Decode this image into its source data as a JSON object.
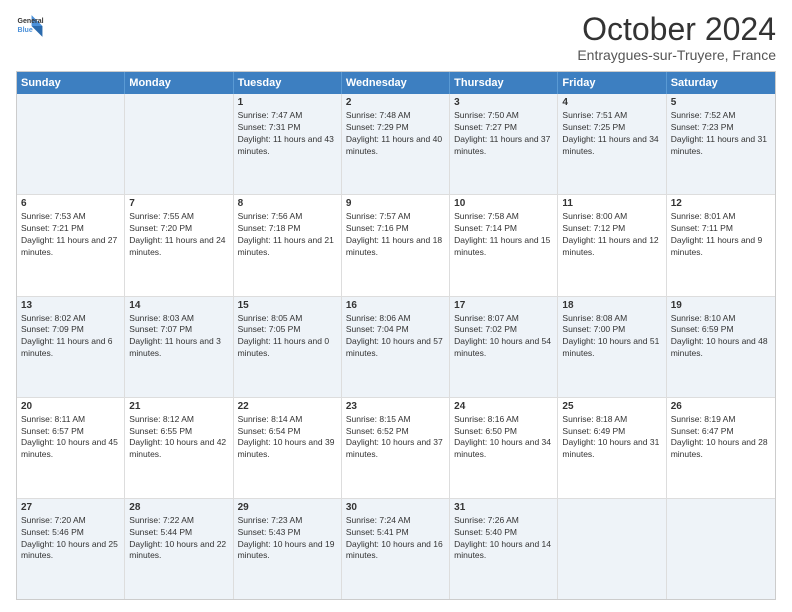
{
  "logo": {
    "line1": "General",
    "line2": "Blue"
  },
  "title": "October 2024",
  "location": "Entraygues-sur-Truyere, France",
  "header": {
    "days": [
      "Sunday",
      "Monday",
      "Tuesday",
      "Wednesday",
      "Thursday",
      "Friday",
      "Saturday"
    ]
  },
  "weeks": [
    [
      {
        "day": "",
        "sunrise": "",
        "sunset": "",
        "daylight": "",
        "empty": true
      },
      {
        "day": "",
        "sunrise": "",
        "sunset": "",
        "daylight": "",
        "empty": true
      },
      {
        "day": "1",
        "sunrise": "Sunrise: 7:47 AM",
        "sunset": "Sunset: 7:31 PM",
        "daylight": "Daylight: 11 hours and 43 minutes."
      },
      {
        "day": "2",
        "sunrise": "Sunrise: 7:48 AM",
        "sunset": "Sunset: 7:29 PM",
        "daylight": "Daylight: 11 hours and 40 minutes."
      },
      {
        "day": "3",
        "sunrise": "Sunrise: 7:50 AM",
        "sunset": "Sunset: 7:27 PM",
        "daylight": "Daylight: 11 hours and 37 minutes."
      },
      {
        "day": "4",
        "sunrise": "Sunrise: 7:51 AM",
        "sunset": "Sunset: 7:25 PM",
        "daylight": "Daylight: 11 hours and 34 minutes."
      },
      {
        "day": "5",
        "sunrise": "Sunrise: 7:52 AM",
        "sunset": "Sunset: 7:23 PM",
        "daylight": "Daylight: 11 hours and 31 minutes."
      }
    ],
    [
      {
        "day": "6",
        "sunrise": "Sunrise: 7:53 AM",
        "sunset": "Sunset: 7:21 PM",
        "daylight": "Daylight: 11 hours and 27 minutes."
      },
      {
        "day": "7",
        "sunrise": "Sunrise: 7:55 AM",
        "sunset": "Sunset: 7:20 PM",
        "daylight": "Daylight: 11 hours and 24 minutes."
      },
      {
        "day": "8",
        "sunrise": "Sunrise: 7:56 AM",
        "sunset": "Sunset: 7:18 PM",
        "daylight": "Daylight: 11 hours and 21 minutes."
      },
      {
        "day": "9",
        "sunrise": "Sunrise: 7:57 AM",
        "sunset": "Sunset: 7:16 PM",
        "daylight": "Daylight: 11 hours and 18 minutes."
      },
      {
        "day": "10",
        "sunrise": "Sunrise: 7:58 AM",
        "sunset": "Sunset: 7:14 PM",
        "daylight": "Daylight: 11 hours and 15 minutes."
      },
      {
        "day": "11",
        "sunrise": "Sunrise: 8:00 AM",
        "sunset": "Sunset: 7:12 PM",
        "daylight": "Daylight: 11 hours and 12 minutes."
      },
      {
        "day": "12",
        "sunrise": "Sunrise: 8:01 AM",
        "sunset": "Sunset: 7:11 PM",
        "daylight": "Daylight: 11 hours and 9 minutes."
      }
    ],
    [
      {
        "day": "13",
        "sunrise": "Sunrise: 8:02 AM",
        "sunset": "Sunset: 7:09 PM",
        "daylight": "Daylight: 11 hours and 6 minutes."
      },
      {
        "day": "14",
        "sunrise": "Sunrise: 8:03 AM",
        "sunset": "Sunset: 7:07 PM",
        "daylight": "Daylight: 11 hours and 3 minutes."
      },
      {
        "day": "15",
        "sunrise": "Sunrise: 8:05 AM",
        "sunset": "Sunset: 7:05 PM",
        "daylight": "Daylight: 11 hours and 0 minutes."
      },
      {
        "day": "16",
        "sunrise": "Sunrise: 8:06 AM",
        "sunset": "Sunset: 7:04 PM",
        "daylight": "Daylight: 10 hours and 57 minutes."
      },
      {
        "day": "17",
        "sunrise": "Sunrise: 8:07 AM",
        "sunset": "Sunset: 7:02 PM",
        "daylight": "Daylight: 10 hours and 54 minutes."
      },
      {
        "day": "18",
        "sunrise": "Sunrise: 8:08 AM",
        "sunset": "Sunset: 7:00 PM",
        "daylight": "Daylight: 10 hours and 51 minutes."
      },
      {
        "day": "19",
        "sunrise": "Sunrise: 8:10 AM",
        "sunset": "Sunset: 6:59 PM",
        "daylight": "Daylight: 10 hours and 48 minutes."
      }
    ],
    [
      {
        "day": "20",
        "sunrise": "Sunrise: 8:11 AM",
        "sunset": "Sunset: 6:57 PM",
        "daylight": "Daylight: 10 hours and 45 minutes."
      },
      {
        "day": "21",
        "sunrise": "Sunrise: 8:12 AM",
        "sunset": "Sunset: 6:55 PM",
        "daylight": "Daylight: 10 hours and 42 minutes."
      },
      {
        "day": "22",
        "sunrise": "Sunrise: 8:14 AM",
        "sunset": "Sunset: 6:54 PM",
        "daylight": "Daylight: 10 hours and 39 minutes."
      },
      {
        "day": "23",
        "sunrise": "Sunrise: 8:15 AM",
        "sunset": "Sunset: 6:52 PM",
        "daylight": "Daylight: 10 hours and 37 minutes."
      },
      {
        "day": "24",
        "sunrise": "Sunrise: 8:16 AM",
        "sunset": "Sunset: 6:50 PM",
        "daylight": "Daylight: 10 hours and 34 minutes."
      },
      {
        "day": "25",
        "sunrise": "Sunrise: 8:18 AM",
        "sunset": "Sunset: 6:49 PM",
        "daylight": "Daylight: 10 hours and 31 minutes."
      },
      {
        "day": "26",
        "sunrise": "Sunrise: 8:19 AM",
        "sunset": "Sunset: 6:47 PM",
        "daylight": "Daylight: 10 hours and 28 minutes."
      }
    ],
    [
      {
        "day": "27",
        "sunrise": "Sunrise: 7:20 AM",
        "sunset": "Sunset: 5:46 PM",
        "daylight": "Daylight: 10 hours and 25 minutes."
      },
      {
        "day": "28",
        "sunrise": "Sunrise: 7:22 AM",
        "sunset": "Sunset: 5:44 PM",
        "daylight": "Daylight: 10 hours and 22 minutes."
      },
      {
        "day": "29",
        "sunrise": "Sunrise: 7:23 AM",
        "sunset": "Sunset: 5:43 PM",
        "daylight": "Daylight: 10 hours and 19 minutes."
      },
      {
        "day": "30",
        "sunrise": "Sunrise: 7:24 AM",
        "sunset": "Sunset: 5:41 PM",
        "daylight": "Daylight: 10 hours and 16 minutes."
      },
      {
        "day": "31",
        "sunrise": "Sunrise: 7:26 AM",
        "sunset": "Sunset: 5:40 PM",
        "daylight": "Daylight: 10 hours and 14 minutes."
      },
      {
        "day": "",
        "sunrise": "",
        "sunset": "",
        "daylight": "",
        "empty": true
      },
      {
        "day": "",
        "sunrise": "",
        "sunset": "",
        "daylight": "",
        "empty": true
      }
    ]
  ],
  "alt_rows": [
    0,
    2,
    4
  ]
}
